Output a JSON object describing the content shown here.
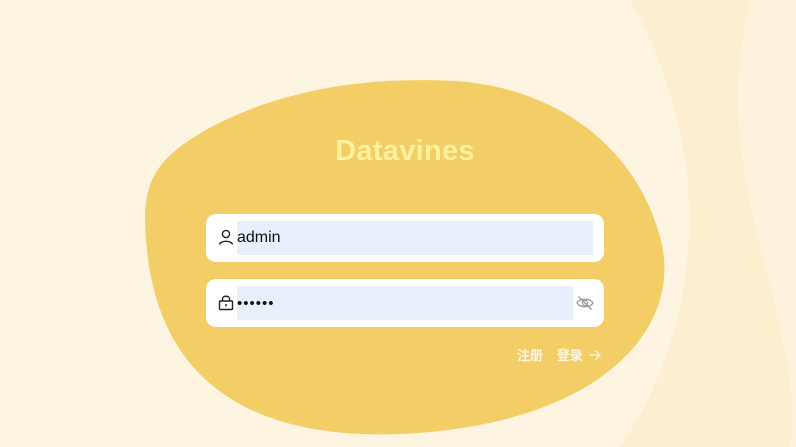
{
  "app": {
    "title": "Datavines"
  },
  "colors": {
    "background": "#fdf4e2",
    "blob": "#f3ce66",
    "title": "#fdf1a0",
    "input_fill": "#e8f0fc"
  },
  "login_form": {
    "username": {
      "icon": "user-icon",
      "value": "admin"
    },
    "password": {
      "icon": "lock-icon",
      "value": "••••••",
      "toggle_icon": "eye-off-icon"
    }
  },
  "links": {
    "register": "注册",
    "login": "登录",
    "login_icon": "arrow-right-icon"
  }
}
